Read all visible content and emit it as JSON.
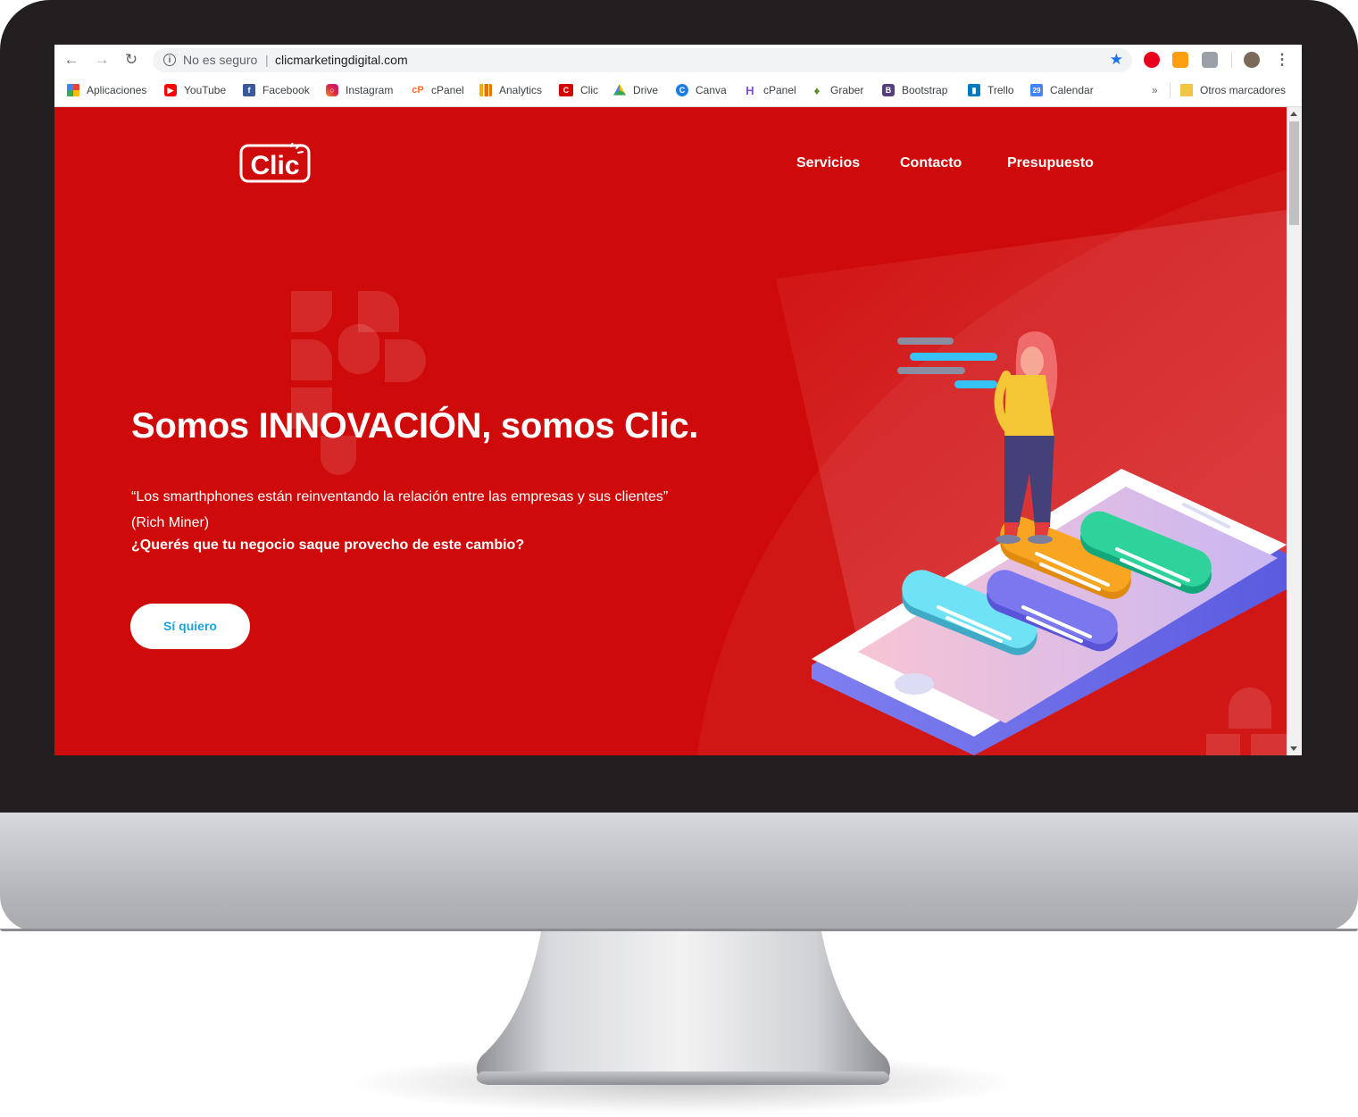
{
  "browser": {
    "security_label": "No es seguro",
    "separator": "|",
    "url": "clicmarketingdigital.com"
  },
  "bookmarks": [
    {
      "label": "Aplicaciones",
      "icon": "apps-grid-icon",
      "color": "#4285f4"
    },
    {
      "label": "YouTube",
      "icon": "youtube-icon",
      "color": "#ff0000"
    },
    {
      "label": "Facebook",
      "icon": "facebook-icon",
      "color": "#3b5998"
    },
    {
      "label": "Instagram",
      "icon": "instagram-icon",
      "color": "#c13584"
    },
    {
      "label": "cPanel",
      "icon": "cpanel-icon",
      "color": "#ff6c2c"
    },
    {
      "label": "Analytics",
      "icon": "analytics-icon",
      "color": "#f9ab00"
    },
    {
      "label": "Clic",
      "icon": "clic-icon",
      "color": "#d50000"
    },
    {
      "label": "Drive",
      "icon": "drive-icon",
      "color": "#34a853"
    },
    {
      "label": "Canva",
      "icon": "canva-icon",
      "color": "#00c4cc"
    },
    {
      "label": "cPanel",
      "icon": "cpanel-h-icon",
      "color": "#7b4fd6"
    },
    {
      "label": "Graber",
      "icon": "graber-icon",
      "color": "#5a8f29"
    },
    {
      "label": "Bootstrap",
      "icon": "bootstrap-icon",
      "color": "#563d7c"
    },
    {
      "label": "Trello",
      "icon": "trello-icon",
      "color": "#0079bf"
    },
    {
      "label": "Calendar",
      "icon": "calendar-icon",
      "color": "#4285f4"
    }
  ],
  "bookmarks_overflow": "»",
  "other_bookmarks": "Otros marcadores",
  "site": {
    "logo_text": "Clic",
    "nav": [
      "Servicios",
      "Contacto",
      "Presupuesto"
    ],
    "headline": "Somos INNOVACIÓN, somos Clic.",
    "quote": "“Los smarthphones están reinventando la relación entre las empresas y sus clientes” (Rich Miner)",
    "question": "¿Querés que tu negocio saque provecho de este cambio?",
    "cta": "Sí quiero"
  },
  "colors": {
    "brand_red": "#cf0a0a",
    "cta_text": "#1fa3e0",
    "bezel": "#231f20"
  }
}
